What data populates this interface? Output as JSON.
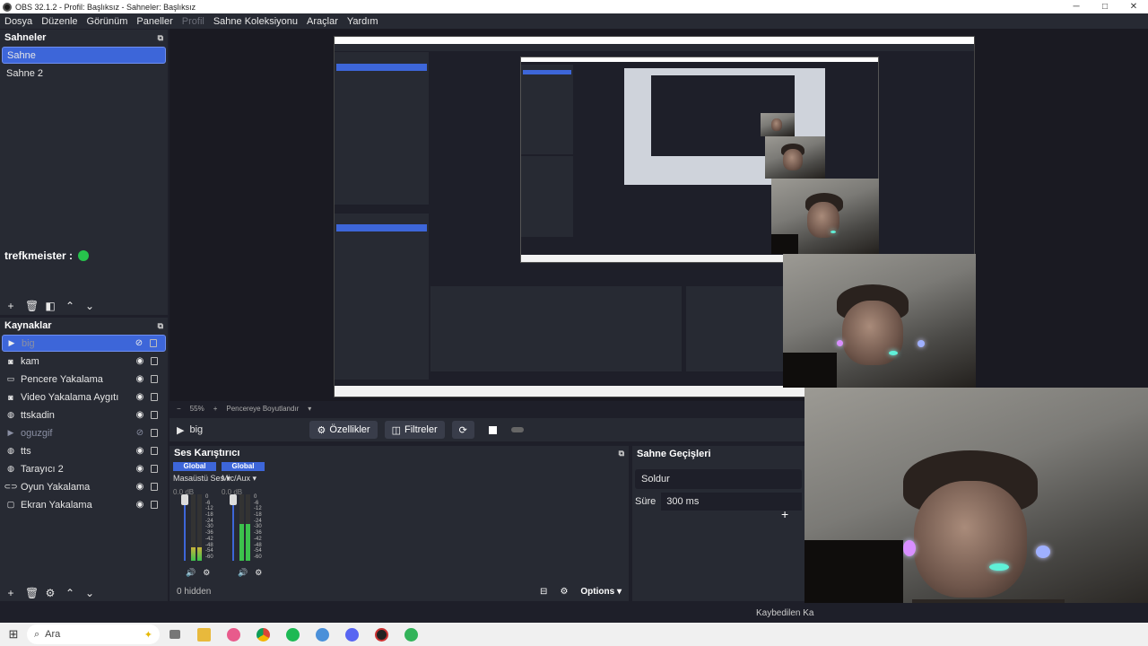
{
  "window": {
    "title": "OBS 32.1.2 - Profil: Başlıksız - Sahneler: Başlıksız",
    "minimize": "─",
    "maximize": "□",
    "close": "✕"
  },
  "menu": [
    "Dosya",
    "Düzenle",
    "Görünüm",
    "Paneller",
    "Profil",
    "Sahne Koleksiyonu",
    "Araçlar",
    "Yardım"
  ],
  "scenes": {
    "title": "Sahneler",
    "items": [
      "Sahne",
      "Sahne 2"
    ],
    "selected": 0
  },
  "user_tag": "trefkmeister :",
  "sources": {
    "title": "Kaynaklar",
    "items": [
      {
        "label": "big",
        "icon": "play-icon",
        "visible": false,
        "selected": true,
        "dim": true
      },
      {
        "label": "kam",
        "icon": "camera-icon",
        "visible": true
      },
      {
        "label": "Pencere Yakalama",
        "icon": "window-icon",
        "visible": true
      },
      {
        "label": "Video Yakalama Aygıtı",
        "icon": "camera-icon",
        "visible": true
      },
      {
        "label": "ttskadin",
        "icon": "globe-icon",
        "visible": true
      },
      {
        "label": "oguzgif",
        "icon": "play-icon",
        "visible": false,
        "dim": true
      },
      {
        "label": "tts",
        "icon": "globe-icon",
        "visible": true
      },
      {
        "label": "Tarayıcı 2",
        "icon": "globe-icon",
        "visible": true
      },
      {
        "label": "Oyun Yakalama",
        "icon": "gamepad-icon",
        "visible": true
      },
      {
        "label": "Ekran Yakalama",
        "icon": "monitor-icon",
        "visible": true
      }
    ]
  },
  "zoom": {
    "minus": "−",
    "level": "55%",
    "plus": "+",
    "fit": "Pencereye Boyutlandır"
  },
  "controls": {
    "current_source": "big",
    "properties": "Özellikler",
    "filters": "Filtreler"
  },
  "mixer": {
    "title": "Ses Karıştırıcı",
    "channels": [
      {
        "tag": "Global",
        "name": "Masaüstü Ses",
        "db": "0.0 dB",
        "level": 0.2
      },
      {
        "tag": "Global",
        "name": "Mic/Aux",
        "db": "0.0 dB",
        "level": 0.55
      }
    ],
    "scale": [
      "0",
      "-6",
      "-12",
      "-18",
      "-24",
      "-30",
      "-36",
      "-42",
      "-48",
      "-54",
      "-60"
    ],
    "hidden": "0 hidden",
    "options": "Options"
  },
  "transitions": {
    "title": "Sahne Geçişleri",
    "selected": "Soldur",
    "duration_label": "Süre",
    "duration": "300 ms"
  },
  "status": {
    "dropped": "Kaybedilen Ka"
  },
  "taskbar": {
    "search": "Ara"
  },
  "colors": {
    "accent": "#3d66d9",
    "panel": "#272a33",
    "bg": "#1e1f29"
  }
}
